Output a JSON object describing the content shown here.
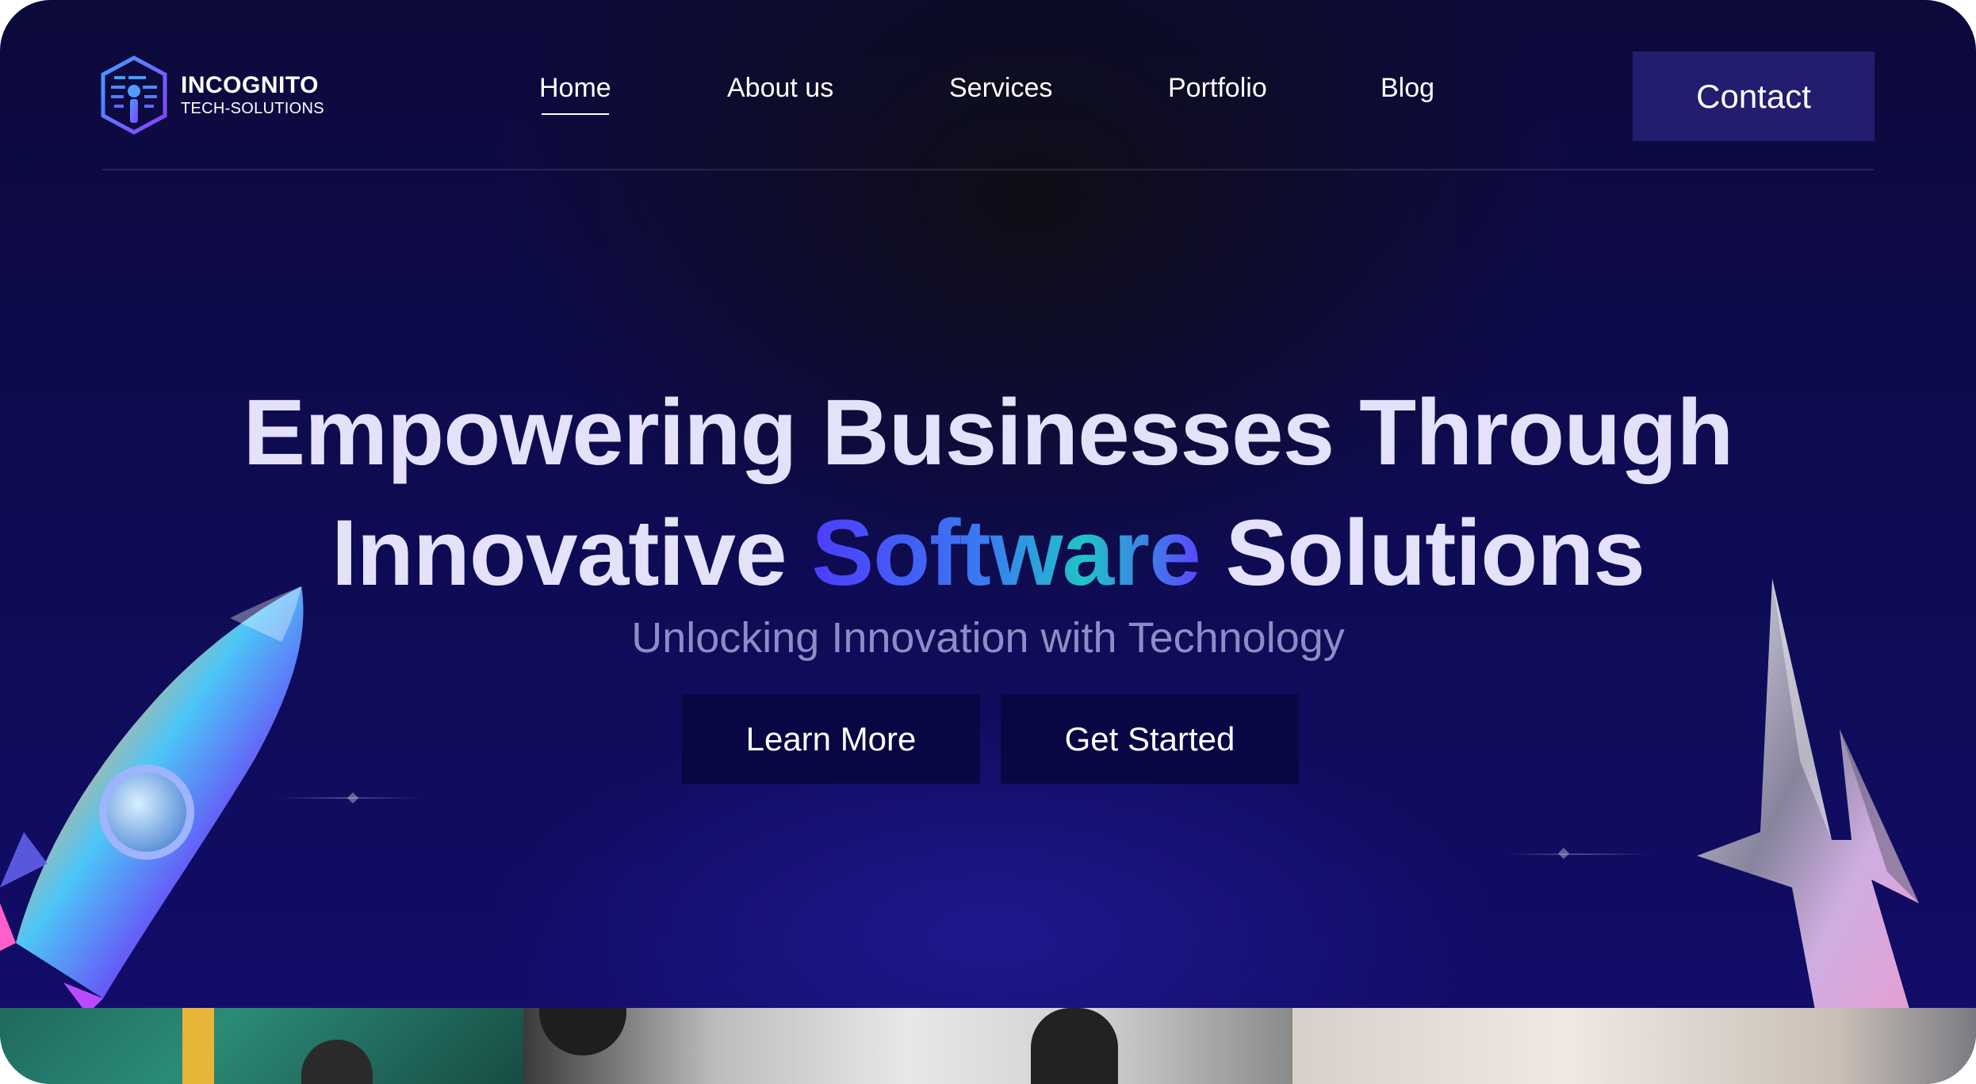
{
  "brand": {
    "name": "INCOGNITO",
    "tagline": "TECH-SOLUTIONS",
    "colors": {
      "background": "#0e0b52",
      "accent": "#4d3cff",
      "button": "#080744",
      "contact": "#221d6e"
    }
  },
  "nav": {
    "items": [
      {
        "label": "Home",
        "active": true
      },
      {
        "label": "About us",
        "active": false
      },
      {
        "label": "Services",
        "active": false
      },
      {
        "label": "Portfolio",
        "active": false
      },
      {
        "label": "Blog",
        "active": false
      }
    ],
    "contact_label": "Contact"
  },
  "hero": {
    "title_line1": "Empowering Businesses Through",
    "title_line2_before": "Innovative ",
    "title_line2_accent": "Software",
    "title_line2_after": " Solutions",
    "subtitle": "Unlocking Innovation with Technology",
    "primary_button": "Learn More",
    "secondary_button": "Get Started"
  },
  "icons": [
    "logo-shield-icon",
    "rocket-illustration",
    "lightning-bolt-illustration"
  ]
}
